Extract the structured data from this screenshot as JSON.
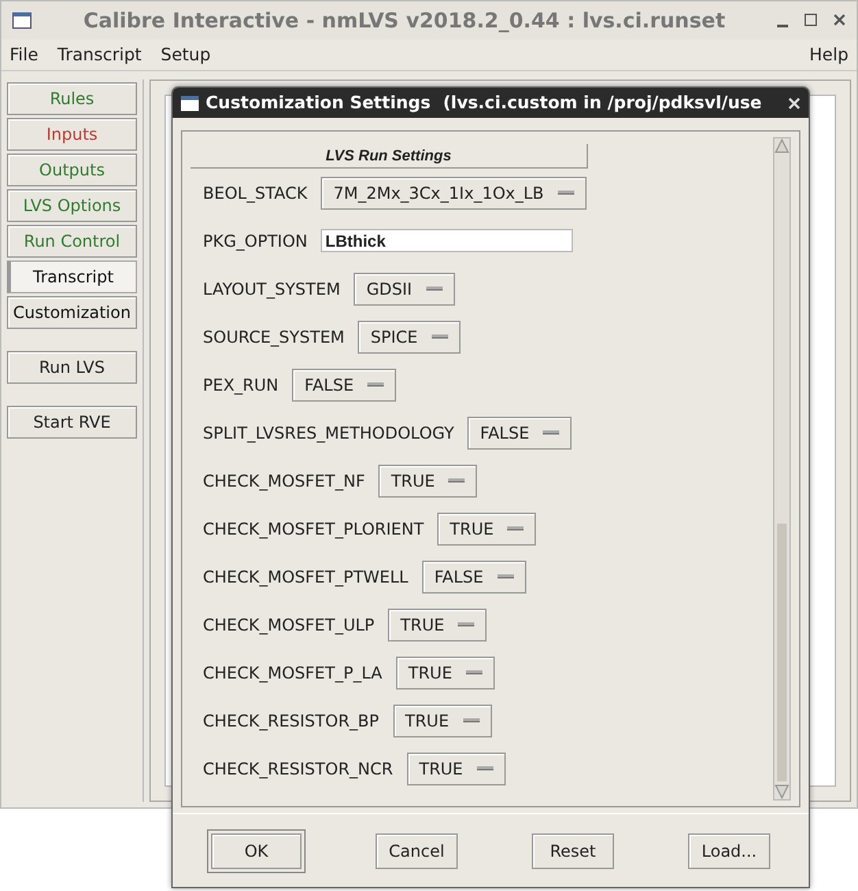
{
  "window": {
    "title": "Calibre Interactive - nmLVS v2018.2_0.44 : lvs.ci.runset"
  },
  "menu": [
    {
      "label": "File"
    },
    {
      "label": "Transcript"
    },
    {
      "label": "Setup"
    },
    {
      "label": "Help"
    }
  ],
  "sidebar": {
    "items": [
      {
        "label": "Rules",
        "color": "#2e7d2e",
        "selected": false
      },
      {
        "label": "Inputs",
        "color": "#c0392b",
        "selected": false
      },
      {
        "label": "Outputs",
        "color": "#2e7d2e",
        "selected": false
      },
      {
        "label": "LVS Options",
        "color": "#2e7d2e",
        "selected": false
      },
      {
        "label": "Run Control",
        "color": "#2e7d2e",
        "selected": false
      },
      {
        "label": "Transcript",
        "color": "#111111",
        "selected": true
      },
      {
        "label": "Customization",
        "color": "#111111",
        "selected": false
      }
    ],
    "actions": [
      {
        "label": "Run LVS"
      },
      {
        "label": "Start RVE"
      }
    ]
  },
  "dialog": {
    "title": "Customization Settings",
    "subtitle": "(lvs.ci.custom in /proj/pdksvl/use",
    "section": "LVS Run Settings",
    "rows": [
      {
        "kind": "dropdown",
        "label": "BEOL_STACK",
        "value": "7M_2Mx_3Cx_1Ix_1Ox_LB"
      },
      {
        "kind": "text",
        "label": "PKG_OPTION",
        "value": "LBthick"
      },
      {
        "kind": "dropdown",
        "label": "LAYOUT_SYSTEM",
        "value": "GDSII"
      },
      {
        "kind": "dropdown",
        "label": "SOURCE_SYSTEM",
        "value": "SPICE"
      },
      {
        "kind": "dropdown",
        "label": "PEX_RUN",
        "value": "FALSE"
      },
      {
        "kind": "dropdown",
        "label": "SPLIT_LVSRES_METHODOLOGY",
        "value": "FALSE"
      },
      {
        "kind": "dropdown",
        "label": "CHECK_MOSFET_NF",
        "value": "TRUE"
      },
      {
        "kind": "dropdown",
        "label": "CHECK_MOSFET_PLORIENT",
        "value": "TRUE"
      },
      {
        "kind": "dropdown",
        "label": "CHECK_MOSFET_PTWELL",
        "value": "FALSE"
      },
      {
        "kind": "dropdown",
        "label": "CHECK_MOSFET_ULP",
        "value": "TRUE"
      },
      {
        "kind": "dropdown",
        "label": "CHECK_MOSFET_P_LA",
        "value": "TRUE"
      },
      {
        "kind": "dropdown",
        "label": "CHECK_RESISTOR_BP",
        "value": "TRUE"
      },
      {
        "kind": "dropdown",
        "label": "CHECK_RESISTOR_NCR",
        "value": "TRUE"
      }
    ],
    "buttons": [
      {
        "label": "OK",
        "default": true
      },
      {
        "label": "Cancel",
        "default": false
      },
      {
        "label": "Reset",
        "default": false
      },
      {
        "label": "Load...",
        "default": false
      }
    ]
  }
}
